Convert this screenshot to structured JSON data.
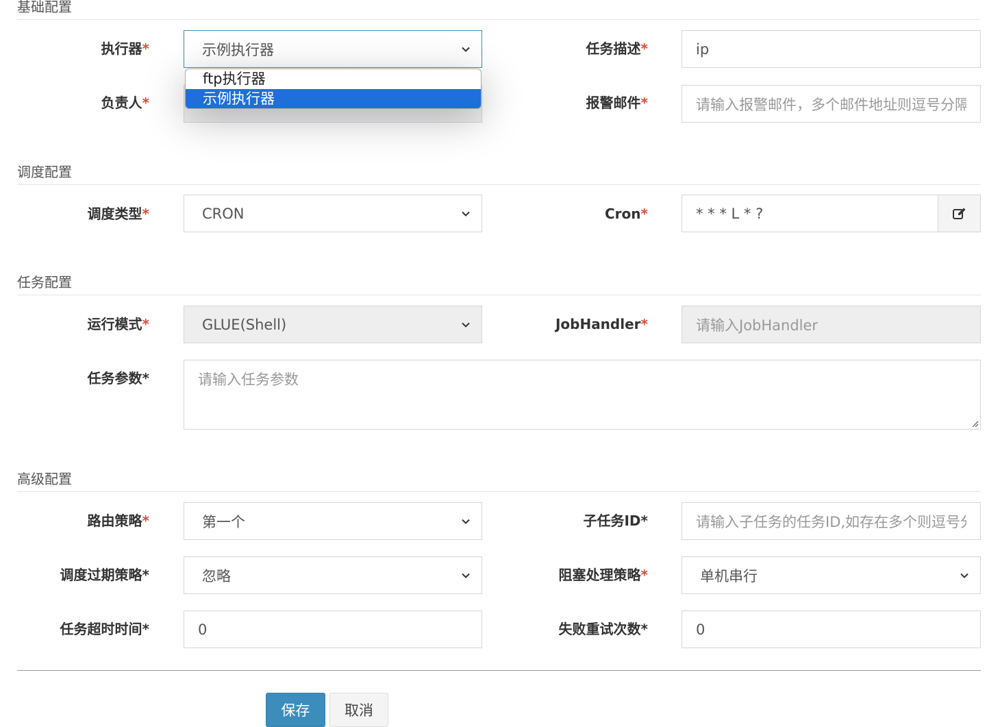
{
  "sections": {
    "basic": "基础配置",
    "schedule": "调度配置",
    "task": "任务配置",
    "advanced": "高级配置"
  },
  "fields": {
    "executor": {
      "label": "执行器",
      "required": "*",
      "value": "示例执行器",
      "options": [
        "ftp执行器",
        "示例执行器"
      ],
      "selected_index": 1
    },
    "desc": {
      "label": "任务描述",
      "required": "*",
      "value": "ip"
    },
    "owner": {
      "label": "负责人",
      "required": "*",
      "value": ""
    },
    "alarm_email": {
      "label": "报警邮件",
      "required": "*",
      "placeholder": "请输入报警邮件，多个邮件地址则逗号分隔"
    },
    "schedule_type": {
      "label": "调度类型",
      "required": "*",
      "value": "CRON"
    },
    "cron": {
      "label": "Cron",
      "required": "*",
      "value": "* * * L * ?"
    },
    "run_mode": {
      "label": "运行模式",
      "required": "*",
      "value": "GLUE(Shell)"
    },
    "job_handler": {
      "label": "JobHandler",
      "required": "*",
      "placeholder": "请输入JobHandler"
    },
    "params": {
      "label": "任务参数",
      "required": "*",
      "placeholder": "请输入任务参数"
    },
    "route": {
      "label": "路由策略",
      "required": "*",
      "value": "第一个"
    },
    "child_id": {
      "label": "子任务ID",
      "required": "*",
      "placeholder": "请输入子任务的任务ID,如存在多个则逗号分隔"
    },
    "misfire": {
      "label": "调度过期策略",
      "required": "*",
      "value": "忽略"
    },
    "block": {
      "label": "阻塞处理策略",
      "required": "*",
      "value": "单机串行"
    },
    "timeout": {
      "label": "任务超时时间",
      "required": "*",
      "value": "0"
    },
    "retry": {
      "label": "失败重试次数",
      "required": "*",
      "value": "0"
    }
  },
  "buttons": {
    "save": "保存",
    "cancel": "取消"
  },
  "colors": {
    "required_star": "#dd4b39",
    "primary": "#3c8dbc",
    "dropdown_highlight": "#1e6fd9"
  }
}
